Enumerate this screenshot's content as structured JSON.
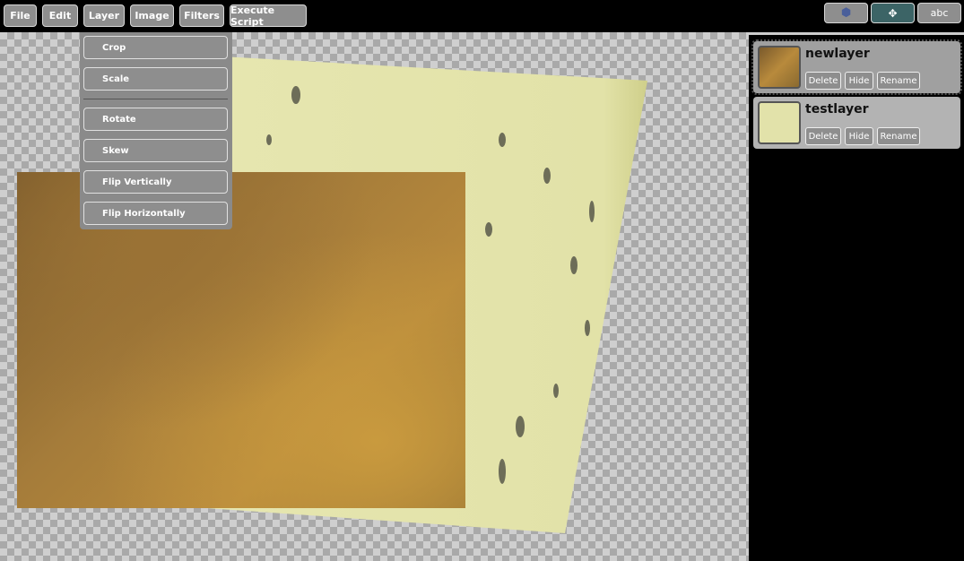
{
  "menubar": {
    "items": [
      "File",
      "Edit",
      "Layer",
      "Image",
      "Filters",
      "Execute Script"
    ]
  },
  "tools": {
    "items": [
      {
        "icon": "hexagon-icon"
      },
      {
        "icon": "move-icon",
        "active": true
      },
      {
        "label": "abc"
      }
    ],
    "active_color": "#3c6466"
  },
  "layer_menu": {
    "items": [
      "Crop",
      "Scale",
      "Rotate",
      "Skew",
      "Flip Vertically",
      "Flip Horizontally"
    ]
  },
  "layers": [
    {
      "name": "newlayer",
      "selected": true,
      "actions": [
        "Delete",
        "Hide",
        "Rename"
      ]
    },
    {
      "name": "testlayer",
      "selected": false,
      "actions": [
        "Delete",
        "Hide",
        "Rename"
      ]
    }
  ]
}
